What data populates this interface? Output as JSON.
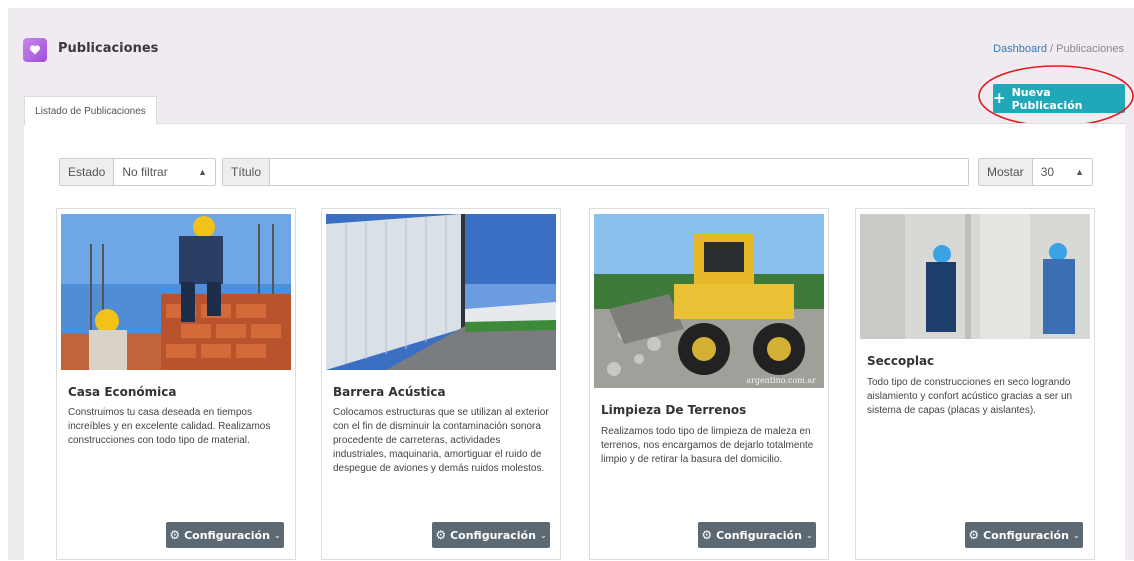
{
  "header": {
    "title": "Publicaciones",
    "icon": "heart-icon"
  },
  "breadcrumb": {
    "link": "Dashboard",
    "separator": " / ",
    "current": "Publicaciones"
  },
  "actions": {
    "new_label": "Nueva Publicación",
    "new_icon": "plus-icon",
    "color": "#20a8b8"
  },
  "tabs": [
    {
      "label": "Listado de Publicaciones",
      "active": true
    }
  ],
  "filters": {
    "estado_label": "Estado",
    "estado_value": "No filtrar",
    "titulo_label": "Título",
    "titulo_value": "",
    "mostrar_label": "Mostar",
    "mostrar_value": "30"
  },
  "cards": [
    {
      "title": "Casa Económica",
      "description": "Construimos tu casa deseada en tiempos increíbles y en excelente calidad. Realizamos construcciones con todo tipo de material.",
      "button": "Configuración",
      "image": "construction-workers-bricks"
    },
    {
      "title": "Barrera Acústica",
      "description": "Colocamos estructuras que se utilizan al exterior con el fin de disminuir la contaminación sonora procedente de carreteras, actividades industriales, maquinaria, amortiguar el ruido de despegue de aviones y demás ruidos molestos.",
      "button": "Configuración",
      "image": "highway-sound-barrier"
    },
    {
      "title": "Limpieza De Terrenos",
      "description": "Realizamos todo tipo de limpieza de maleza en terrenos, nos encargamos de dejarlo totalmente limpio y de retirar la basura del domicilio.",
      "button": "Configuración",
      "image": "yellow-loader-gravel",
      "image_watermark": "argentino.com.ar"
    },
    {
      "title": "Seccoplac",
      "description": "Todo tipo de construcciones en seco logrando aislamiento y confort acústico gracias a ser un sistema de capas (placas y aislantes).",
      "button": "Configuración",
      "image": "drywall-workers"
    }
  ]
}
